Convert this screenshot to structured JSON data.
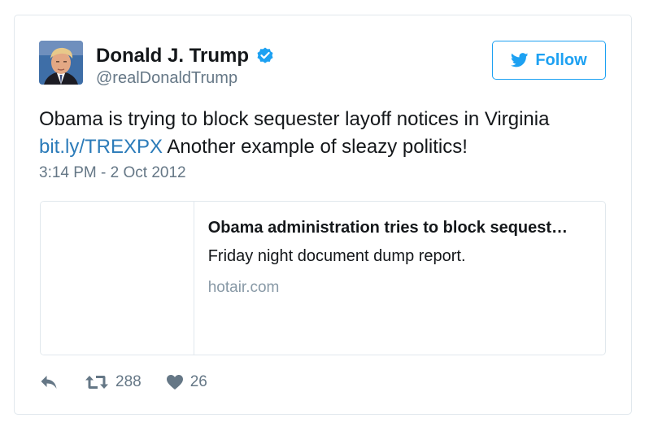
{
  "user": {
    "name": "Donald J. Trump",
    "handle": "@realDonaldTrump",
    "verified_icon": "verified-badge-icon",
    "accent_color": "#1da1f2"
  },
  "follow_button": {
    "label": "Follow",
    "icon": "twitter-bird-icon"
  },
  "tweet": {
    "text_part1": "Obama is trying to block sequester layoff notices in Virginia",
    "link_text": "bit.ly/TREXPX",
    "text_part2": " Another example of sleazy politics!",
    "timestamp": "3:14 PM - 2 Oct 2012"
  },
  "link_card": {
    "title": "Obama administration tries to block sequest…",
    "description": "Friday night document dump report.",
    "domain": "hotair.com"
  },
  "actions": {
    "reply_icon": "reply-icon",
    "retweet_icon": "retweet-icon",
    "retweet_count": "288",
    "like_icon": "heart-icon",
    "like_count": "26"
  }
}
